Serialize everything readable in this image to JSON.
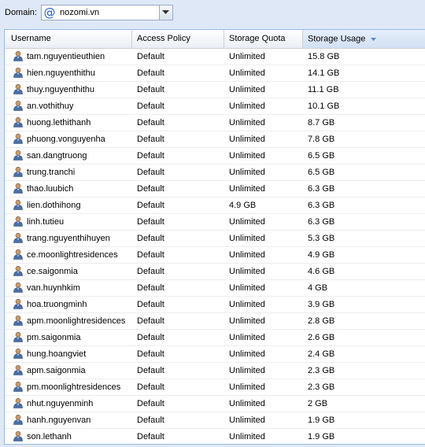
{
  "toolbar": {
    "domain_label": "Domain:",
    "domain_value": "nozomi.vn",
    "domain_icon": "at-icon"
  },
  "grid": {
    "columns": [
      {
        "label": "Username"
      },
      {
        "label": "Access Policy"
      },
      {
        "label": "Storage Quota"
      },
      {
        "label": "Storage Usage",
        "sort": "desc"
      }
    ],
    "rows": [
      {
        "user": "tam.nguyentieuthien",
        "policy": "Default",
        "quota": "Unlimited",
        "usage": "15.8 GB"
      },
      {
        "user": "hien.nguyenthithu",
        "policy": "Default",
        "quota": "Unlimited",
        "usage": "14.1 GB"
      },
      {
        "user": "thuy.nguyenthithu",
        "policy": "Default",
        "quota": "Unlimited",
        "usage": "11.1 GB"
      },
      {
        "user": "an.vothithuy",
        "policy": "Default",
        "quota": "Unlimited",
        "usage": "10.1 GB"
      },
      {
        "user": "huong.lethithanh",
        "policy": "Default",
        "quota": "Unlimited",
        "usage": "8.7 GB"
      },
      {
        "user": "phuong.vonguyenha",
        "policy": "Default",
        "quota": "Unlimited",
        "usage": "7.8 GB"
      },
      {
        "user": "san.dangtruong",
        "policy": "Default",
        "quota": "Unlimited",
        "usage": "6.5 GB"
      },
      {
        "user": "trung.tranchi",
        "policy": "Default",
        "quota": "Unlimited",
        "usage": "6.5 GB"
      },
      {
        "user": "thao.luubich",
        "policy": "Default",
        "quota": "Unlimited",
        "usage": "6.3 GB"
      },
      {
        "user": "lien.dothihong",
        "policy": "Default",
        "quota": "4.9 GB",
        "usage": "6.3 GB"
      },
      {
        "user": "linh.tutieu",
        "policy": "Default",
        "quota": "Unlimited",
        "usage": "6.3 GB"
      },
      {
        "user": "trang.nguyenthihuyen",
        "policy": "Default",
        "quota": "Unlimited",
        "usage": "5.3 GB"
      },
      {
        "user": "ce.moonlightresidences",
        "policy": "Default",
        "quota": "Unlimited",
        "usage": "4.9 GB"
      },
      {
        "user": "ce.saigonmia",
        "policy": "Default",
        "quota": "Unlimited",
        "usage": "4.6 GB"
      },
      {
        "user": "van.huynhkim",
        "policy": "Default",
        "quota": "Unlimited",
        "usage": "4 GB"
      },
      {
        "user": "hoa.truongminh",
        "policy": "Default",
        "quota": "Unlimited",
        "usage": "3.9 GB"
      },
      {
        "user": "apm.moonlightresidences",
        "policy": "Default",
        "quota": "Unlimited",
        "usage": "2.8 GB"
      },
      {
        "user": "pm.saigonmia",
        "policy": "Default",
        "quota": "Unlimited",
        "usage": "2.6 GB"
      },
      {
        "user": "hung.hoangviet",
        "policy": "Default",
        "quota": "Unlimited",
        "usage": "2.4 GB"
      },
      {
        "user": "apm.saigonmia",
        "policy": "Default",
        "quota": "Unlimited",
        "usage": "2.3 GB"
      },
      {
        "user": "pm.moonlightresidences",
        "policy": "Default",
        "quota": "Unlimited",
        "usage": "2.3 GB"
      },
      {
        "user": "nhut.nguyenminh",
        "policy": "Default",
        "quota": "Unlimited",
        "usage": "2 GB"
      },
      {
        "user": "hanh.nguyenvan",
        "policy": "Default",
        "quota": "Unlimited",
        "usage": "1.9 GB"
      },
      {
        "user": "son.lethanh",
        "policy": "Default",
        "quota": "Unlimited",
        "usage": "1.9 GB"
      }
    ]
  },
  "colors": {
    "background": "#dfe8f6",
    "grid_border": "#99bbe8",
    "sort_arrow": "#5b86c8",
    "user_icon": "#4a6fa5"
  }
}
